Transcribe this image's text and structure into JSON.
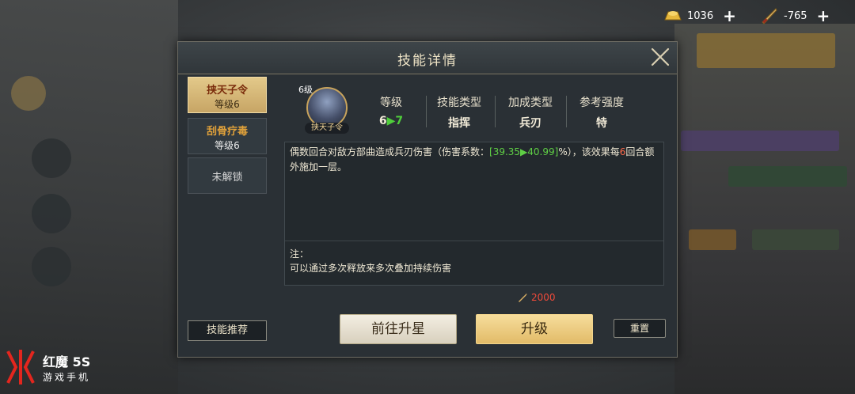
{
  "currency": {
    "gold": {
      "value": "1036",
      "icon": "gold-ingot-icon"
    },
    "tokens": {
      "value": "-765",
      "icon": "sword-token-icon"
    }
  },
  "dialog": {
    "title": "技能详情",
    "tabs": [
      {
        "name": "挟天子令",
        "level": "等级6",
        "active": true
      },
      {
        "name": "刮骨疗毒",
        "level": "等级6",
        "active": false
      },
      {
        "name": "未解锁",
        "level": "",
        "active": false
      }
    ],
    "recommend_label": "技能推荐"
  },
  "skill": {
    "icon_level": "6级",
    "icon_name": "挟天子令",
    "stats": {
      "level_header": "等级",
      "level_from": "6",
      "level_arrow": "▶",
      "level_to": "7",
      "type_header": "技能类型",
      "type_value": "指挥",
      "bonus_header": "加成类型",
      "bonus_value": "兵刃",
      "ref_header": "参考强度",
      "ref_value": "特"
    },
    "description": {
      "part1": "偶数回合对敌方部曲造成兵刃伤害（伤害系数：",
      "coef": "[39.35▶40.99]",
      "part2": "%），该效果每",
      "rounds": "6",
      "part3": "回合额外施加一层。"
    },
    "note_label": "注：",
    "note_text": "可以通过多次释放来多次叠加持续伤害"
  },
  "actions": {
    "cost": "2000",
    "star_button": "前往升星",
    "upgrade_button": "升级",
    "reset_button": "重置"
  },
  "watermark": {
    "brand": "红魔 5S",
    "sub": "游戏手机"
  },
  "colors": {
    "accent_gold": "#e2bb68",
    "level_green": "#4fce3b",
    "cost_red": "#f04a3a"
  }
}
